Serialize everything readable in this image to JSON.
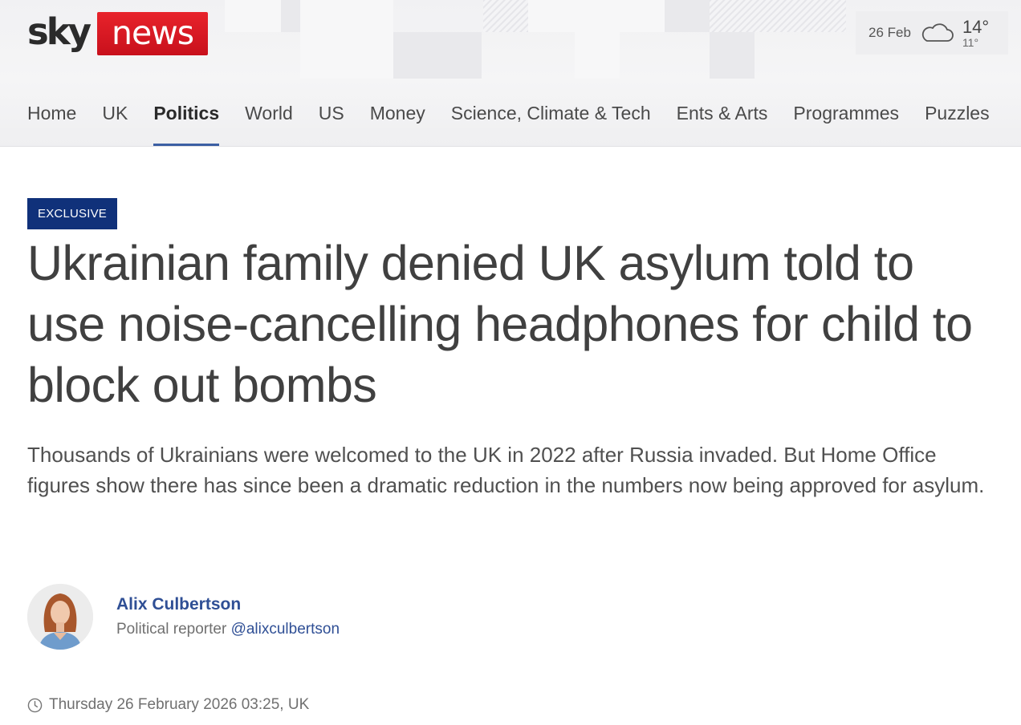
{
  "header": {
    "logo": {
      "sky": "sky",
      "news": "news"
    },
    "weather": {
      "date": "26 Feb",
      "icon": "cloud-icon",
      "high": "14°",
      "low": "11°"
    },
    "nav": [
      {
        "label": "Home",
        "active": false
      },
      {
        "label": "UK",
        "active": false
      },
      {
        "label": "Politics",
        "active": true
      },
      {
        "label": "World",
        "active": false
      },
      {
        "label": "US",
        "active": false
      },
      {
        "label": "Money",
        "active": false
      },
      {
        "label": "Science, Climate & Tech",
        "active": false
      },
      {
        "label": "Ents & Arts",
        "active": false
      },
      {
        "label": "Programmes",
        "active": false
      },
      {
        "label": "Puzzles",
        "active": false
      }
    ]
  },
  "article": {
    "badge": "EXCLUSIVE",
    "headline": "Ukrainian family denied UK asylum told to use noise-cancelling headphones for child to block out bombs",
    "standfirst": "Thousands of Ukrainians were welcomed to the UK in 2022 after Russia invaded. But Home Office figures show there has since been a dramatic reduction in the numbers now being approved for asylum.",
    "author": {
      "name": "Alix Culbertson",
      "role": "Political reporter",
      "handle": "@alixculbertson"
    },
    "timestamp": "Thursday 26 February 2026 03:25, UK"
  },
  "colors": {
    "brand_red": "#d4141f",
    "badge_navy": "#10317a",
    "link_blue": "#2f4f95",
    "nav_underline": "#3c5fa3"
  }
}
